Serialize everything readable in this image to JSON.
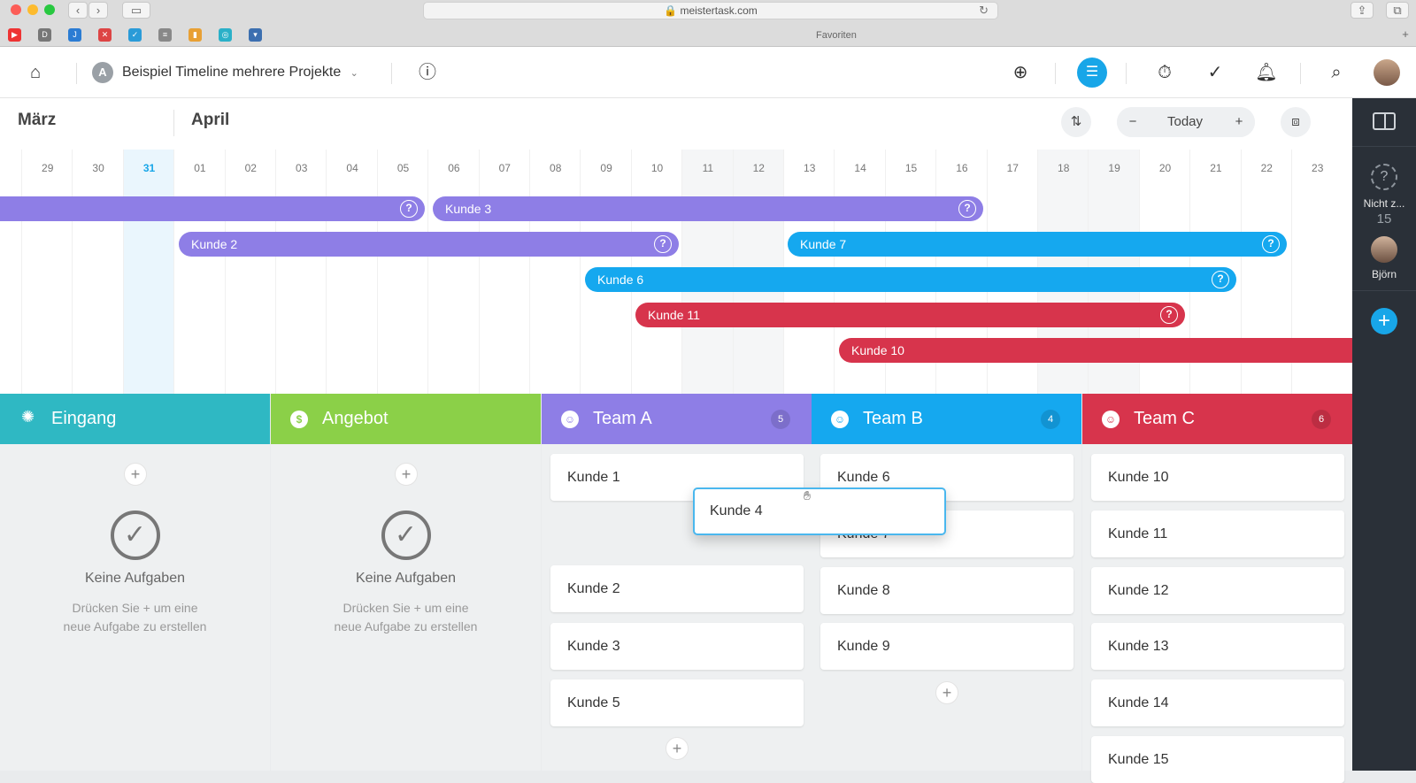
{
  "browser": {
    "url": "meistertask.com",
    "favorites_label": "Favoriten"
  },
  "header": {
    "project_initial": "A",
    "project_title": "Beispiel Timeline mehrere Projekte",
    "dropdown_icon": "chevron-down-icon"
  },
  "timeline": {
    "months": [
      "März",
      "April"
    ],
    "today_label": "Today",
    "days": [
      "29",
      "30",
      "31",
      "01",
      "02",
      "03",
      "04",
      "05",
      "06",
      "07",
      "08",
      "09",
      "10",
      "11",
      "12",
      "13",
      "14",
      "15",
      "16",
      "17",
      "18",
      "19",
      "20",
      "21",
      "22",
      "23"
    ],
    "today_day": "31",
    "bars": [
      {
        "label": "",
        "color": "#8e7ee6"
      },
      {
        "label": "Kunde 3",
        "color": "#8e7ee6"
      },
      {
        "label": "Kunde 2",
        "color": "#8e7ee6"
      },
      {
        "label": "Kunde 7",
        "color": "#15a8ef"
      },
      {
        "label": "Kunde 6",
        "color": "#15a8ef"
      },
      {
        "label": "Kunde 11",
        "color": "#d7344c"
      },
      {
        "label": "Kunde 10",
        "color": "#d7344c"
      }
    ]
  },
  "sidebar": {
    "unassigned_label": "Nicht z...",
    "unassigned_count": "15",
    "user_name": "Björn"
  },
  "board": {
    "columns": [
      {
        "title": "Eingang",
        "color": "#2fb8c3",
        "count": ""
      },
      {
        "title": "Angebot",
        "color": "#8bd048",
        "count": ""
      },
      {
        "title": "Team A",
        "color": "#8e7ee6",
        "count": "5"
      },
      {
        "title": "Team B",
        "color": "#15a8ef",
        "count": "4"
      },
      {
        "title": "Team C",
        "color": "#d7344c",
        "count": "6"
      }
    ],
    "empty_title": "Keine Aufgaben",
    "empty_sub_1": "Drücken Sie + um eine",
    "empty_sub_2": "neue Aufgabe zu erstellen",
    "team_a_cards": [
      "Kunde 1",
      "Kunde 2",
      "Kunde 3",
      "Kunde 5"
    ],
    "team_b_cards": [
      "Kunde 6",
      "Kunde 7",
      "Kunde 8",
      "Kunde 9"
    ],
    "team_c_cards": [
      "Kunde 10",
      "Kunde 11",
      "Kunde 12",
      "Kunde 13",
      "Kunde 14",
      "Kunde 15"
    ],
    "dragging_card": "Kunde 4"
  }
}
